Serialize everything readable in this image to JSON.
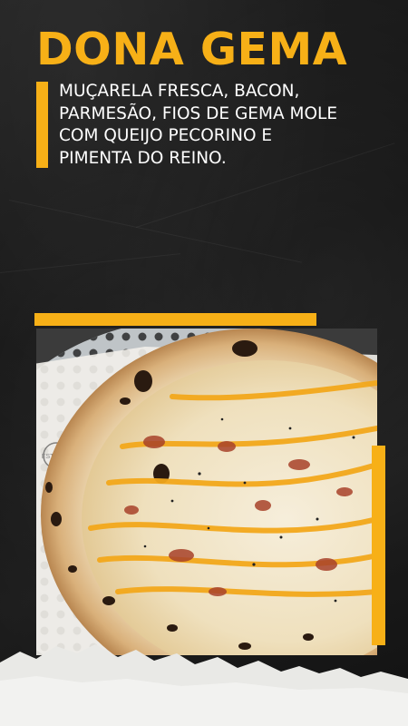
{
  "title": "DONA GEMA",
  "description": "MUÇARELA FRESCA, BACON,\nPARMESÃO, FIOS DE GEMA MOLE\nCOM QUEIJO PECORINO E\nPIMENTA DO REINO.",
  "image": {
    "subject": "pizza",
    "tray_logo_text": "EST. 1930"
  },
  "colors": {
    "accent": "#f7b017",
    "background": "#1a1a1a",
    "text": "#ffffff"
  }
}
